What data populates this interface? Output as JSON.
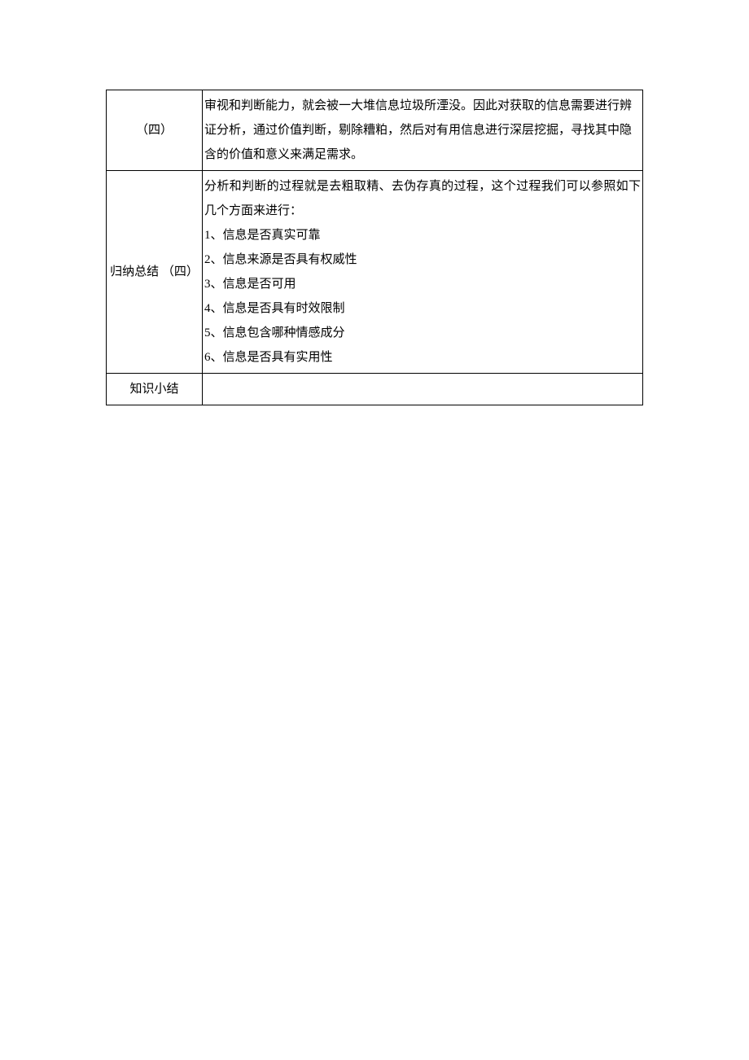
{
  "rows": [
    {
      "label": "（四）",
      "content_type": "paragraph",
      "content": "审视和判断能力，就会被一大堆信息垃圾所湮没。因此对获取的信息需要进行辨证分析，通过价值判断，剔除糟粕，然后对有用信息进行深层挖掘，寻找其中隐含的价值和意义来满足需求。"
    },
    {
      "label_lines": [
        "归纳总结",
        "（四）"
      ],
      "content_type": "lines",
      "lines": [
        "分析和判断的过程就是去粗取精、去伪存真的过程，这个过程我们可以参照如下几个方面来进行：",
        "1、信息是否真实可靠",
        "2、信息来源是否具有权威性",
        "3、信息是否可用",
        "4、信息是否具有时效限制",
        "5、信息包含哪种情感成分",
        "6、信息是否具有实用性"
      ]
    },
    {
      "label": "知识小结",
      "content_type": "empty",
      "content": ""
    }
  ]
}
